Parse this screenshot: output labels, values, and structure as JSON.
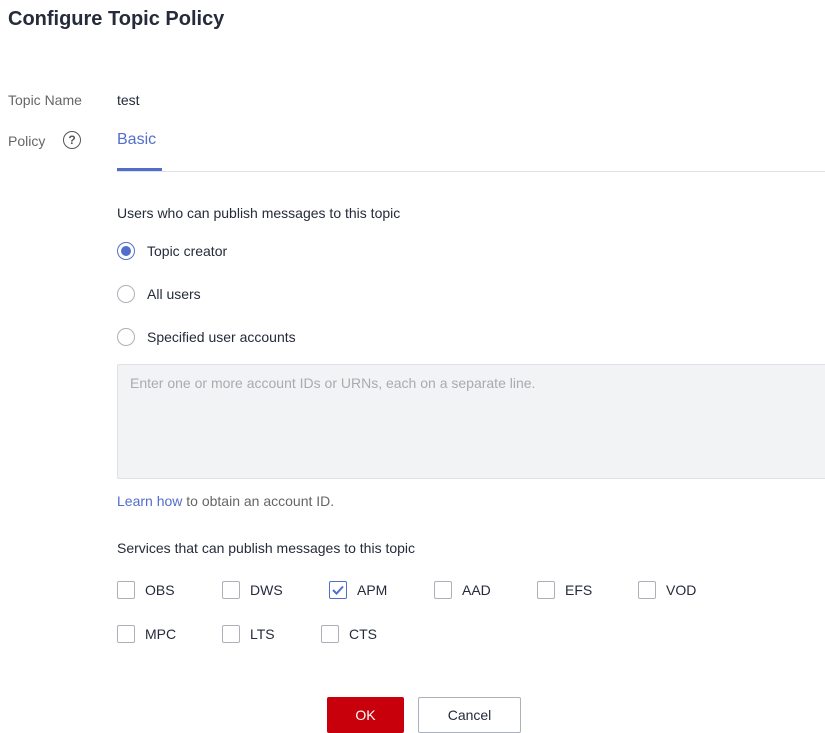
{
  "dialog": {
    "title": "Configure Topic Policy"
  },
  "topic": {
    "label": "Topic Name",
    "value": "test"
  },
  "policy": {
    "label": "Policy",
    "help_glyph": "?",
    "tab_basic": "Basic"
  },
  "publishers": {
    "heading": "Users who can publish messages to this topic",
    "options": [
      {
        "label": "Topic creator",
        "selected": true
      },
      {
        "label": "All users",
        "selected": false
      },
      {
        "label": "Specified user accounts",
        "selected": false
      }
    ],
    "accounts_placeholder": "Enter one or more account IDs or URNs, each on a separate line.",
    "learn_link": "Learn how",
    "learn_suffix": " to obtain an account ID."
  },
  "services": {
    "heading": "Services that can publish messages to this topic",
    "items": [
      {
        "label": "OBS",
        "checked": false
      },
      {
        "label": "DWS",
        "checked": false
      },
      {
        "label": "APM",
        "checked": true
      },
      {
        "label": "AAD",
        "checked": false
      },
      {
        "label": "EFS",
        "checked": false
      },
      {
        "label": "VOD",
        "checked": false
      },
      {
        "label": "MPC",
        "checked": false
      },
      {
        "label": "LTS",
        "checked": false
      },
      {
        "label": "CTS",
        "checked": false
      }
    ]
  },
  "buttons": {
    "ok": "OK",
    "cancel": "Cancel"
  },
  "colors": {
    "accent": "#526ecc",
    "primary_button": "#c7000b"
  }
}
